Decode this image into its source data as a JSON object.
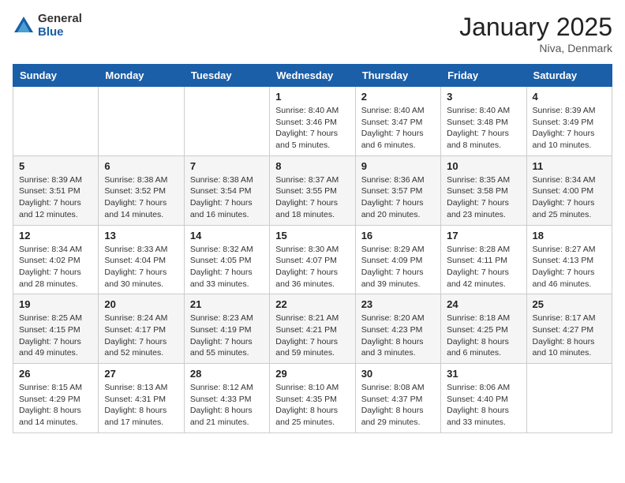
{
  "header": {
    "logo_general": "General",
    "logo_blue": "Blue",
    "month_year": "January 2025",
    "location": "Niva, Denmark"
  },
  "days_of_week": [
    "Sunday",
    "Monday",
    "Tuesday",
    "Wednesday",
    "Thursday",
    "Friday",
    "Saturday"
  ],
  "weeks": [
    [
      {
        "day": "",
        "info": ""
      },
      {
        "day": "",
        "info": ""
      },
      {
        "day": "",
        "info": ""
      },
      {
        "day": "1",
        "info": "Sunrise: 8:40 AM\nSunset: 3:46 PM\nDaylight: 7 hours\nand 5 minutes."
      },
      {
        "day": "2",
        "info": "Sunrise: 8:40 AM\nSunset: 3:47 PM\nDaylight: 7 hours\nand 6 minutes."
      },
      {
        "day": "3",
        "info": "Sunrise: 8:40 AM\nSunset: 3:48 PM\nDaylight: 7 hours\nand 8 minutes."
      },
      {
        "day": "4",
        "info": "Sunrise: 8:39 AM\nSunset: 3:49 PM\nDaylight: 7 hours\nand 10 minutes."
      }
    ],
    [
      {
        "day": "5",
        "info": "Sunrise: 8:39 AM\nSunset: 3:51 PM\nDaylight: 7 hours\nand 12 minutes."
      },
      {
        "day": "6",
        "info": "Sunrise: 8:38 AM\nSunset: 3:52 PM\nDaylight: 7 hours\nand 14 minutes."
      },
      {
        "day": "7",
        "info": "Sunrise: 8:38 AM\nSunset: 3:54 PM\nDaylight: 7 hours\nand 16 minutes."
      },
      {
        "day": "8",
        "info": "Sunrise: 8:37 AM\nSunset: 3:55 PM\nDaylight: 7 hours\nand 18 minutes."
      },
      {
        "day": "9",
        "info": "Sunrise: 8:36 AM\nSunset: 3:57 PM\nDaylight: 7 hours\nand 20 minutes."
      },
      {
        "day": "10",
        "info": "Sunrise: 8:35 AM\nSunset: 3:58 PM\nDaylight: 7 hours\nand 23 minutes."
      },
      {
        "day": "11",
        "info": "Sunrise: 8:34 AM\nSunset: 4:00 PM\nDaylight: 7 hours\nand 25 minutes."
      }
    ],
    [
      {
        "day": "12",
        "info": "Sunrise: 8:34 AM\nSunset: 4:02 PM\nDaylight: 7 hours\nand 28 minutes."
      },
      {
        "day": "13",
        "info": "Sunrise: 8:33 AM\nSunset: 4:04 PM\nDaylight: 7 hours\nand 30 minutes."
      },
      {
        "day": "14",
        "info": "Sunrise: 8:32 AM\nSunset: 4:05 PM\nDaylight: 7 hours\nand 33 minutes."
      },
      {
        "day": "15",
        "info": "Sunrise: 8:30 AM\nSunset: 4:07 PM\nDaylight: 7 hours\nand 36 minutes."
      },
      {
        "day": "16",
        "info": "Sunrise: 8:29 AM\nSunset: 4:09 PM\nDaylight: 7 hours\nand 39 minutes."
      },
      {
        "day": "17",
        "info": "Sunrise: 8:28 AM\nSunset: 4:11 PM\nDaylight: 7 hours\nand 42 minutes."
      },
      {
        "day": "18",
        "info": "Sunrise: 8:27 AM\nSunset: 4:13 PM\nDaylight: 7 hours\nand 46 minutes."
      }
    ],
    [
      {
        "day": "19",
        "info": "Sunrise: 8:25 AM\nSunset: 4:15 PM\nDaylight: 7 hours\nand 49 minutes."
      },
      {
        "day": "20",
        "info": "Sunrise: 8:24 AM\nSunset: 4:17 PM\nDaylight: 7 hours\nand 52 minutes."
      },
      {
        "day": "21",
        "info": "Sunrise: 8:23 AM\nSunset: 4:19 PM\nDaylight: 7 hours\nand 55 minutes."
      },
      {
        "day": "22",
        "info": "Sunrise: 8:21 AM\nSunset: 4:21 PM\nDaylight: 7 hours\nand 59 minutes."
      },
      {
        "day": "23",
        "info": "Sunrise: 8:20 AM\nSunset: 4:23 PM\nDaylight: 8 hours\nand 3 minutes."
      },
      {
        "day": "24",
        "info": "Sunrise: 8:18 AM\nSunset: 4:25 PM\nDaylight: 8 hours\nand 6 minutes."
      },
      {
        "day": "25",
        "info": "Sunrise: 8:17 AM\nSunset: 4:27 PM\nDaylight: 8 hours\nand 10 minutes."
      }
    ],
    [
      {
        "day": "26",
        "info": "Sunrise: 8:15 AM\nSunset: 4:29 PM\nDaylight: 8 hours\nand 14 minutes."
      },
      {
        "day": "27",
        "info": "Sunrise: 8:13 AM\nSunset: 4:31 PM\nDaylight: 8 hours\nand 17 minutes."
      },
      {
        "day": "28",
        "info": "Sunrise: 8:12 AM\nSunset: 4:33 PM\nDaylight: 8 hours\nand 21 minutes."
      },
      {
        "day": "29",
        "info": "Sunrise: 8:10 AM\nSunset: 4:35 PM\nDaylight: 8 hours\nand 25 minutes."
      },
      {
        "day": "30",
        "info": "Sunrise: 8:08 AM\nSunset: 4:37 PM\nDaylight: 8 hours\nand 29 minutes."
      },
      {
        "day": "31",
        "info": "Sunrise: 8:06 AM\nSunset: 4:40 PM\nDaylight: 8 hours\nand 33 minutes."
      },
      {
        "day": "",
        "info": ""
      }
    ]
  ]
}
